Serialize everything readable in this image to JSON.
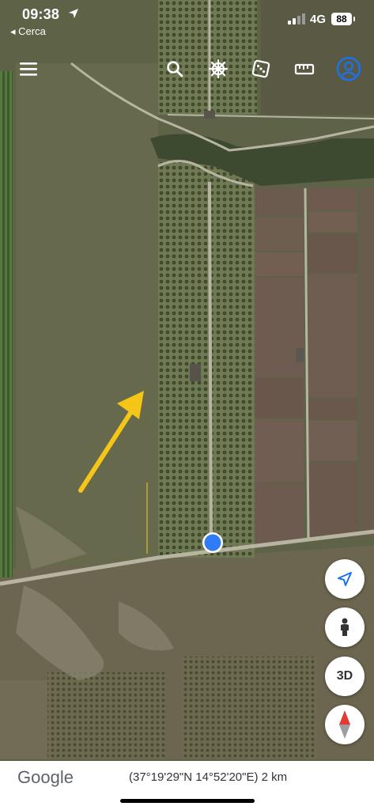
{
  "status_bar": {
    "time": "09:38",
    "back_label": "◂ Cerca",
    "network": "4G",
    "battery": "88"
  },
  "toolbar": {
    "icons": [
      "menu-icon",
      "search-icon",
      "voyager-wheel-icon",
      "dice-icon",
      "ruler-icon",
      "account-icon"
    ],
    "accent_color": "#1a73e8"
  },
  "map_controls": {
    "location_icon": "location-arrow-icon",
    "pegman_icon": "pegman-icon",
    "view_3d_label": "3D",
    "compass_icon": "compass-icon"
  },
  "annotation": {
    "arrow_color": "#f5c518"
  },
  "footer": {
    "logo": "Google",
    "coordinates_scale": "(37°19'29\"N 14°52'20\"E) 2 km"
  }
}
